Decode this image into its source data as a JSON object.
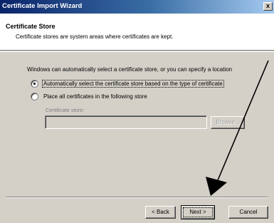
{
  "window": {
    "title": "Certificate Import Wizard",
    "close_label": "x"
  },
  "header": {
    "title": "Certificate Store",
    "description": "Certificate stores are system areas where certificates are kept."
  },
  "main": {
    "intro": "Windows can automatically select a certificate store, or you can specify a location",
    "options": [
      {
        "label": "Automatically select the certificate store based on the type of certificate",
        "checked": true
      },
      {
        "label": "Place all certificates in the following store",
        "checked": false
      }
    ],
    "store_label": "Certificate store:",
    "store_value": "",
    "browse_label": "Browse..."
  },
  "footer": {
    "back_label": "< Back",
    "next_label": "Next >",
    "cancel_label": "Cancel"
  },
  "colors": {
    "titlebar_start": "#0a246a",
    "titlebar_end": "#a6caf0",
    "face": "#d4d0c8",
    "annotation_arrow": "#000000"
  }
}
